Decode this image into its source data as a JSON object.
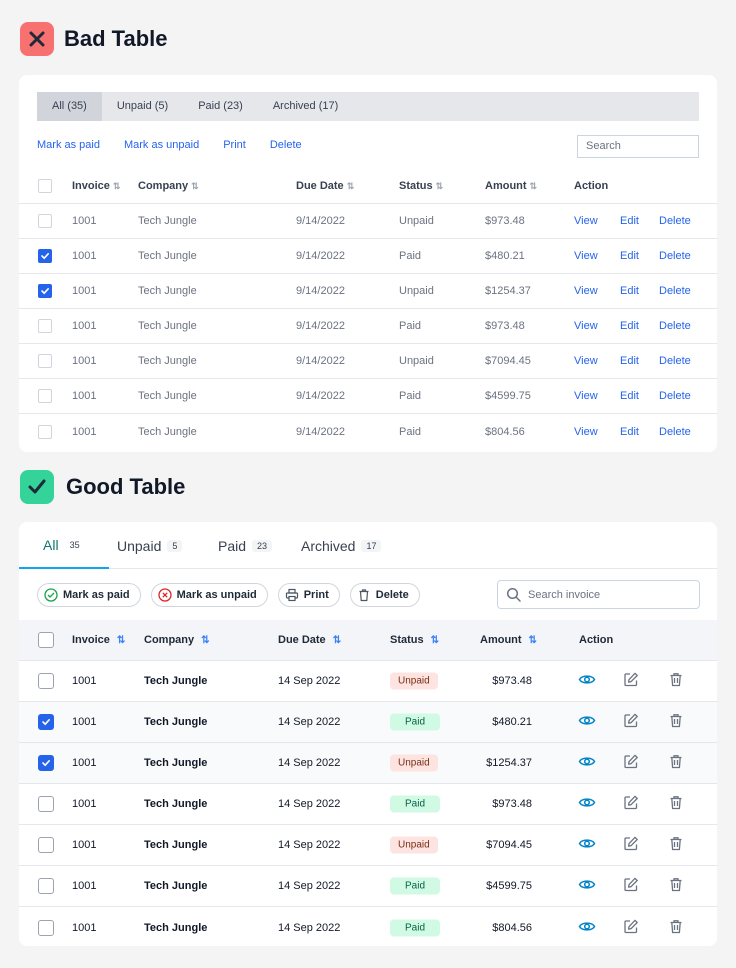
{
  "bad": {
    "title": "Bad Table",
    "tabs": [
      "All (35)",
      "Unpaid (5)",
      "Paid (23)",
      "Archived (17)"
    ],
    "actions": [
      "Mark as paid",
      "Mark as unpaid",
      "Print",
      "Delete"
    ],
    "search_placeholder": "Search",
    "columns": {
      "invoice": "Invoice",
      "company": "Company",
      "due": "Due Date",
      "status": "Status",
      "amount": "Amount",
      "action": "Action"
    },
    "row_actions": {
      "view": "View",
      "edit": "Edit",
      "delete": "Delete"
    },
    "rows": [
      {
        "checked": false,
        "invoice": "1001",
        "company": "Tech Jungle",
        "due": "9/14/2022",
        "status": "Unpaid",
        "amount": "$973.48"
      },
      {
        "checked": true,
        "invoice": "1001",
        "company": "Tech Jungle",
        "due": "9/14/2022",
        "status": "Paid",
        "amount": "$480.21"
      },
      {
        "checked": true,
        "invoice": "1001",
        "company": "Tech Jungle",
        "due": "9/14/2022",
        "status": "Unpaid",
        "amount": "$1254.37"
      },
      {
        "checked": false,
        "invoice": "1001",
        "company": "Tech Jungle",
        "due": "9/14/2022",
        "status": "Paid",
        "amount": "$973.48"
      },
      {
        "checked": false,
        "invoice": "1001",
        "company": "Tech Jungle",
        "due": "9/14/2022",
        "status": "Unpaid",
        "amount": "$7094.45"
      },
      {
        "checked": false,
        "invoice": "1001",
        "company": "Tech Jungle",
        "due": "9/14/2022",
        "status": "Paid",
        "amount": "$4599.75"
      },
      {
        "checked": false,
        "invoice": "1001",
        "company": "Tech Jungle",
        "due": "9/14/2022",
        "status": "Paid",
        "amount": "$804.56"
      }
    ]
  },
  "good": {
    "title": "Good Table",
    "tabs": [
      {
        "label": "All",
        "count": "35"
      },
      {
        "label": "Unpaid",
        "count": "5"
      },
      {
        "label": "Paid",
        "count": "23"
      },
      {
        "label": "Archived",
        "count": "17"
      }
    ],
    "actions": [
      "Mark as paid",
      "Mark as unpaid",
      "Print",
      "Delete"
    ],
    "search_placeholder": "Search invoice",
    "columns": {
      "invoice": "Invoice",
      "company": "Company",
      "due": "Due Date",
      "status": "Status",
      "amount": "Amount",
      "action": "Action"
    },
    "rows": [
      {
        "checked": false,
        "invoice": "1001",
        "company": "Tech Jungle",
        "due": "14 Sep 2022",
        "status": "Unpaid",
        "amount": "$973.48"
      },
      {
        "checked": true,
        "invoice": "1001",
        "company": "Tech Jungle",
        "due": "14 Sep 2022",
        "status": "Paid",
        "amount": "$480.21"
      },
      {
        "checked": true,
        "invoice": "1001",
        "company": "Tech Jungle",
        "due": "14 Sep 2022",
        "status": "Unpaid",
        "amount": "$1254.37"
      },
      {
        "checked": false,
        "invoice": "1001",
        "company": "Tech Jungle",
        "due": "14 Sep 2022",
        "status": "Paid",
        "amount": "$973.48"
      },
      {
        "checked": false,
        "invoice": "1001",
        "company": "Tech Jungle",
        "due": "14 Sep 2022",
        "status": "Unpaid",
        "amount": "$7094.45"
      },
      {
        "checked": false,
        "invoice": "1001",
        "company": "Tech Jungle",
        "due": "14 Sep 2022",
        "status": "Paid",
        "amount": "$4599.75"
      },
      {
        "checked": false,
        "invoice": "1001",
        "company": "Tech Jungle",
        "due": "14 Sep 2022",
        "status": "Paid",
        "amount": "$804.56"
      }
    ]
  },
  "colors": {
    "bad_icon": "#f87171",
    "good_icon": "#34d399",
    "link": "#2563eb",
    "accent": "#0ea5e9"
  },
  "icons": [
    "close-icon",
    "check-icon",
    "sort-icon",
    "search-icon",
    "check-circle-icon",
    "x-circle-icon",
    "printer-icon",
    "trash-icon",
    "eye-icon",
    "edit-icon"
  ]
}
